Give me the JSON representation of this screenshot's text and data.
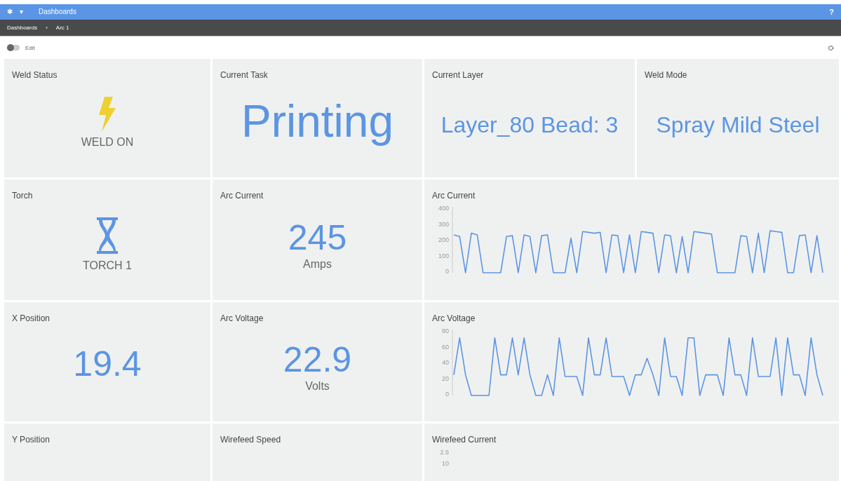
{
  "top_bar": {
    "menu_icon": "✱",
    "caret": "▾",
    "title": "Dashboards",
    "help": "?"
  },
  "breadcrumb": [
    {
      "label": "Dashboards"
    },
    {
      "label": "›"
    },
    {
      "label": "Arc 1"
    }
  ],
  "edit_toggle": {
    "label": "Edit",
    "on": false
  },
  "tiles": [
    {
      "kind": "weld",
      "title": "Weld Status",
      "label": "WELD ON"
    },
    {
      "kind": "headline",
      "title": "Current Task",
      "value": "Printing"
    },
    {
      "kind": "text",
      "title": "Current Layer",
      "value": "Layer_80 Bead: 3"
    },
    {
      "kind": "text",
      "title": "Weld Mode",
      "value": "Spray Mild Steel"
    },
    {
      "kind": "torch",
      "title": "Torch",
      "label": "TORCH 1"
    },
    {
      "kind": "number",
      "title": "Arc Current",
      "value": "245",
      "unit": "Amps"
    },
    {
      "kind": "chart",
      "title": "Arc Current",
      "chart_data": {
        "type": "line",
        "ylim": [
          0,
          400
        ],
        "yticks": [
          0,
          100,
          200,
          300,
          400
        ],
        "series": [
          {
            "color": "#5c95e2",
            "values": [
              230,
              220,
              0,
              240,
              230,
              0,
              0,
              0,
              0,
              220,
              225,
              0,
              230,
              220,
              0,
              225,
              230,
              0,
              0,
              0,
              210,
              0,
              250,
              245,
              240,
              245,
              0,
              230,
              225,
              0,
              230,
              0,
              250,
              245,
              240,
              0,
              230,
              225,
              0,
              220,
              0,
              250,
              245,
              240,
              235,
              0,
              0,
              0,
              0,
              225,
              220,
              0,
              240,
              0,
              255,
              250,
              245,
              0,
              0,
              225,
              230,
              0,
              225,
              0
            ]
          }
        ]
      }
    },
    {
      "kind": "number",
      "title": "X Position",
      "value": "19.4"
    },
    {
      "kind": "number",
      "title": "Arc Voltage",
      "value": "22.9",
      "unit": "Volts"
    },
    {
      "kind": "chart",
      "title": "Arc Voltage",
      "chart_data": {
        "type": "line",
        "ylim": [
          0,
          80
        ],
        "yticks": [
          0,
          20,
          40,
          60,
          80
        ],
        "series": [
          {
            "color": "#5c95e2",
            "values": [
              25,
              70,
              25,
              0,
              0,
              0,
              0,
              70,
              25,
              25,
              70,
              25,
              70,
              25,
              0,
              0,
              25,
              0,
              70,
              23,
              23,
              23,
              0,
              70,
              25,
              25,
              70,
              23,
              23,
              23,
              0,
              25,
              25,
              45,
              25,
              0,
              70,
              23,
              23,
              0,
              70,
              70,
              0,
              25,
              25,
              25,
              0,
              70,
              25,
              25,
              0,
              70,
              23,
              23,
              23,
              70,
              0,
              70,
              25,
              25,
              0,
              70,
              25,
              0
            ]
          }
        ]
      }
    },
    {
      "kind": "cut",
      "title": "Y Position"
    },
    {
      "kind": "cut",
      "title": "Wirefeed Speed"
    },
    {
      "kind": "axis",
      "title": "Wirefeed Current",
      "ticks": [
        "2.5",
        "10"
      ]
    }
  ]
}
